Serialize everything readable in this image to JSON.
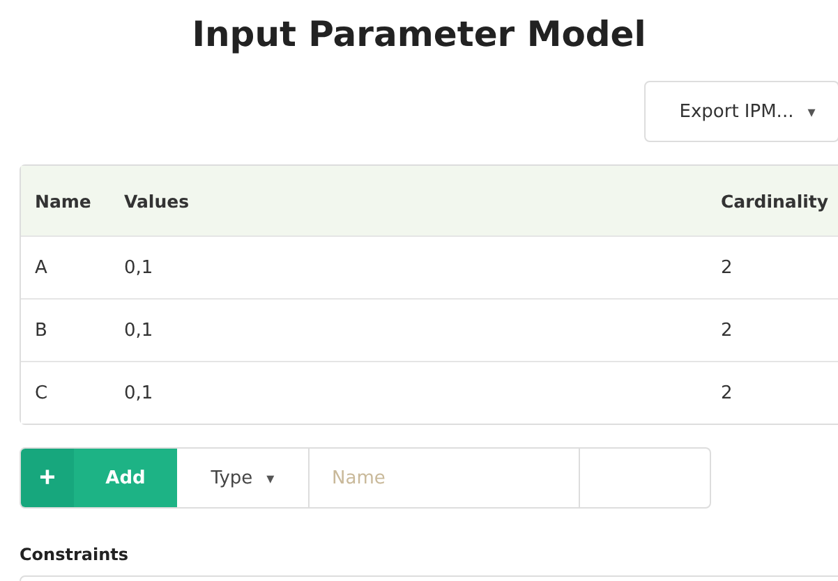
{
  "title": "Input Parameter Model",
  "export_button": {
    "label": "Export IPM...",
    "caret": "▾"
  },
  "table": {
    "columns": [
      "Name",
      "Values",
      "Cardinality"
    ],
    "rows": [
      {
        "name": "A",
        "values": "0,1",
        "cardinality": "2"
      },
      {
        "name": "B",
        "values": "0,1",
        "cardinality": "2"
      },
      {
        "name": "C",
        "values": "0,1",
        "cardinality": "2"
      }
    ]
  },
  "add_bar": {
    "plus": "+",
    "add": "Add",
    "type": "Type",
    "caret": "▾",
    "name_placeholder": "Name"
  },
  "constraints": {
    "label": "Constraints"
  }
}
